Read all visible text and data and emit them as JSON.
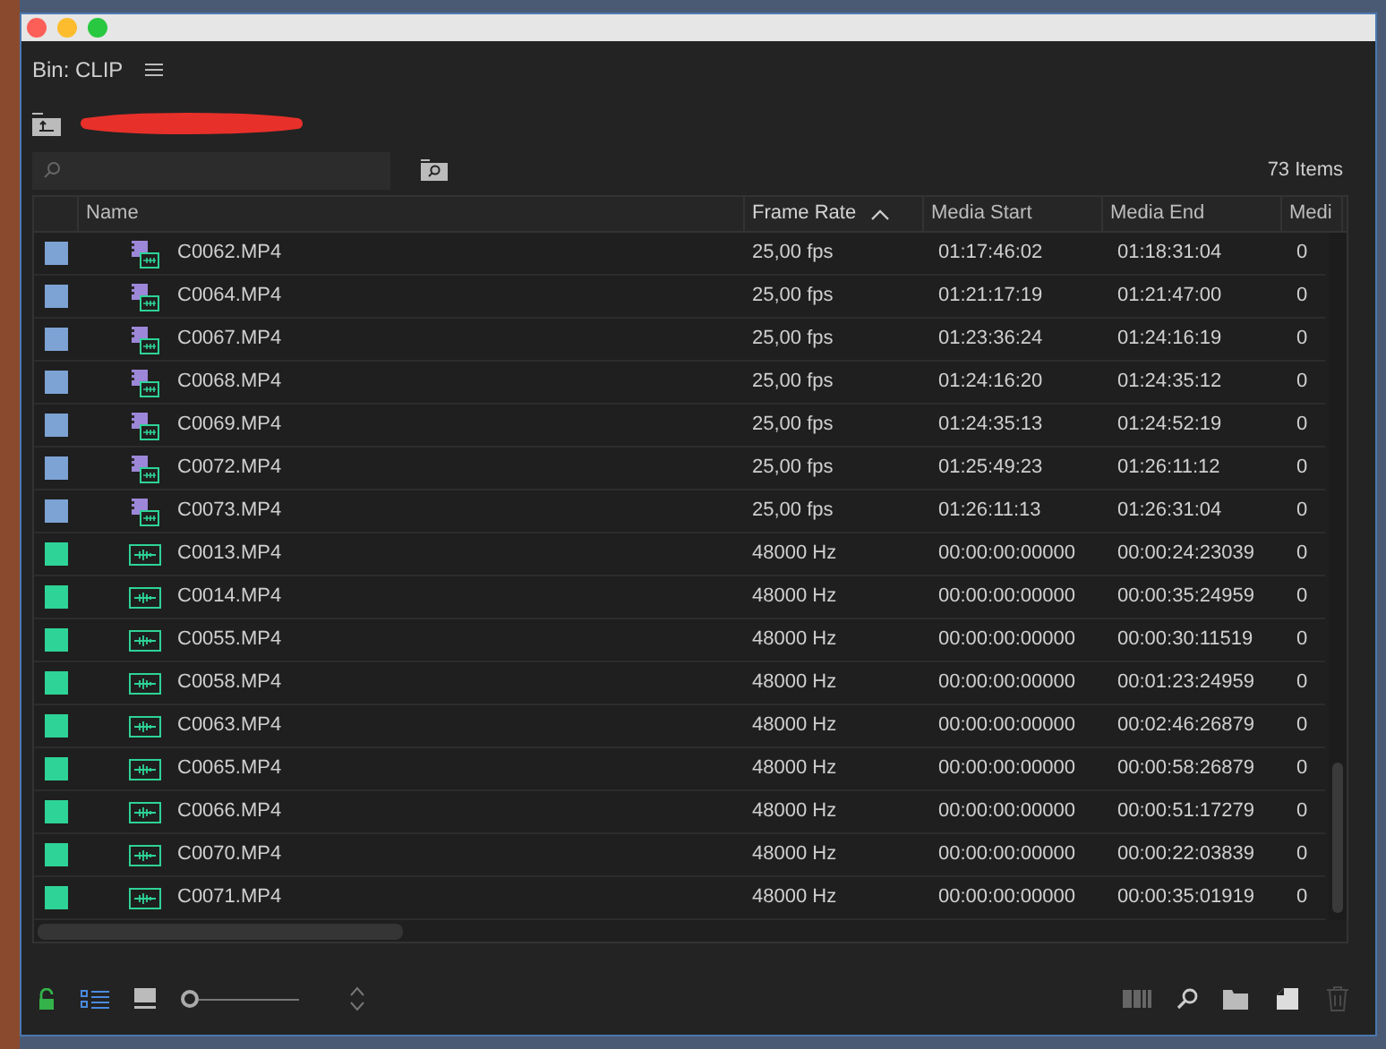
{
  "window": {
    "title": "Bin: CLIP"
  },
  "item_count": "73 Items",
  "table": {
    "columns": [
      {
        "label": "Name",
        "sorted": false
      },
      {
        "label": "Frame Rate",
        "sorted": true
      },
      {
        "label": "Media Start",
        "sorted": false
      },
      {
        "label": "Media End",
        "sorted": false
      },
      {
        "label": "Medi",
        "sorted": false
      }
    ],
    "rows": [
      {
        "kind": "video",
        "color": "#7da2d4",
        "name": "C0062.MP4",
        "rate": "25,00 fps",
        "start": "01:17:46:02",
        "end": "01:18:31:04",
        "column_5": "0"
      },
      {
        "kind": "video",
        "color": "#7da2d4",
        "name": "C0064.MP4",
        "rate": "25,00 fps",
        "start": "01:21:17:19",
        "end": "01:21:47:00",
        "column_5": "0"
      },
      {
        "kind": "video",
        "color": "#7da2d4",
        "name": "C0067.MP4",
        "rate": "25,00 fps",
        "start": "01:23:36:24",
        "end": "01:24:16:19",
        "column_5": "0"
      },
      {
        "kind": "video",
        "color": "#7da2d4",
        "name": "C0068.MP4",
        "rate": "25,00 fps",
        "start": "01:24:16:20",
        "end": "01:24:35:12",
        "column_5": "0"
      },
      {
        "kind": "video",
        "color": "#7da2d4",
        "name": "C0069.MP4",
        "rate": "25,00 fps",
        "start": "01:24:35:13",
        "end": "01:24:52:19",
        "column_5": "0"
      },
      {
        "kind": "video",
        "color": "#7da2d4",
        "name": "C0072.MP4",
        "rate": "25,00 fps",
        "start": "01:25:49:23",
        "end": "01:26:11:12",
        "column_5": "0"
      },
      {
        "kind": "video",
        "color": "#7da2d4",
        "name": "C0073.MP4",
        "rate": "25,00 fps",
        "start": "01:26:11:13",
        "end": "01:26:31:04",
        "column_5": "0"
      },
      {
        "kind": "audio",
        "color": "#2ed397",
        "name": "C0013.MP4",
        "rate": "48000 Hz",
        "start": "00:00:00:00000",
        "end": "00:00:24:23039",
        "column_5": "0"
      },
      {
        "kind": "audio",
        "color": "#2ed397",
        "name": "C0014.MP4",
        "rate": "48000 Hz",
        "start": "00:00:00:00000",
        "end": "00:00:35:24959",
        "column_5": "0"
      },
      {
        "kind": "audio",
        "color": "#2ed397",
        "name": "C0055.MP4",
        "rate": "48000 Hz",
        "start": "00:00:00:00000",
        "end": "00:00:30:11519",
        "column_5": "0"
      },
      {
        "kind": "audio",
        "color": "#2ed397",
        "name": "C0058.MP4",
        "rate": "48000 Hz",
        "start": "00:00:00:00000",
        "end": "00:01:23:24959",
        "column_5": "0"
      },
      {
        "kind": "audio",
        "color": "#2ed397",
        "name": "C0063.MP4",
        "rate": "48000 Hz",
        "start": "00:00:00:00000",
        "end": "00:02:46:26879",
        "column_5": "0"
      },
      {
        "kind": "audio",
        "color": "#2ed397",
        "name": "C0065.MP4",
        "rate": "48000 Hz",
        "start": "00:00:00:00000",
        "end": "00:00:58:26879",
        "column_5": "0"
      },
      {
        "kind": "audio",
        "color": "#2ed397",
        "name": "C0066.MP4",
        "rate": "48000 Hz",
        "start": "00:00:00:00000",
        "end": "00:00:51:17279",
        "column_5": "0"
      },
      {
        "kind": "audio",
        "color": "#2ed397",
        "name": "C0070.MP4",
        "rate": "48000 Hz",
        "start": "00:00:00:00000",
        "end": "00:00:22:03839",
        "column_5": "0"
      },
      {
        "kind": "audio",
        "color": "#2ed397",
        "name": "C0071.MP4",
        "rate": "48000 Hz",
        "start": "00:00:00:00000",
        "end": "00:00:35:01919",
        "column_5": "0"
      }
    ]
  },
  "footer": {
    "zoom": {
      "level": 0.0
    }
  }
}
